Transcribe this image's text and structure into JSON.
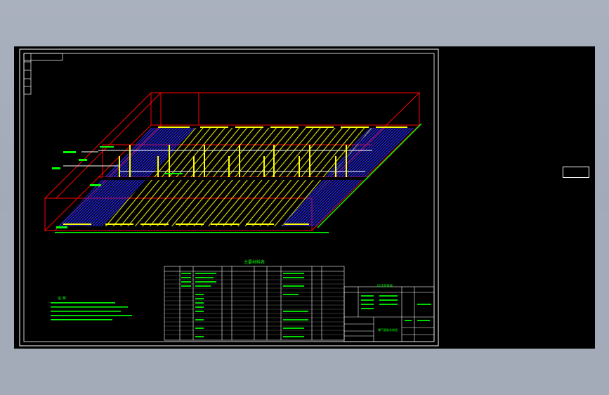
{
  "drawing": {
    "table_title": "主要材料表",
    "notes_heading": "说 明",
    "title_block_name": "曝气管路系统图",
    "revision_tables": [
      "设计变更表",
      "设 计 图 纸"
    ]
  },
  "viewport_label": {
    "line1": "",
    "line2": ""
  },
  "colors": {
    "background": "#a3aab8",
    "canvas": "#000000",
    "frame": "#ffffff",
    "tank": "#ff0000",
    "hatch_yellow": "#ffff00",
    "hatch_blue": "#3a3aff",
    "text": "#00ff00"
  }
}
